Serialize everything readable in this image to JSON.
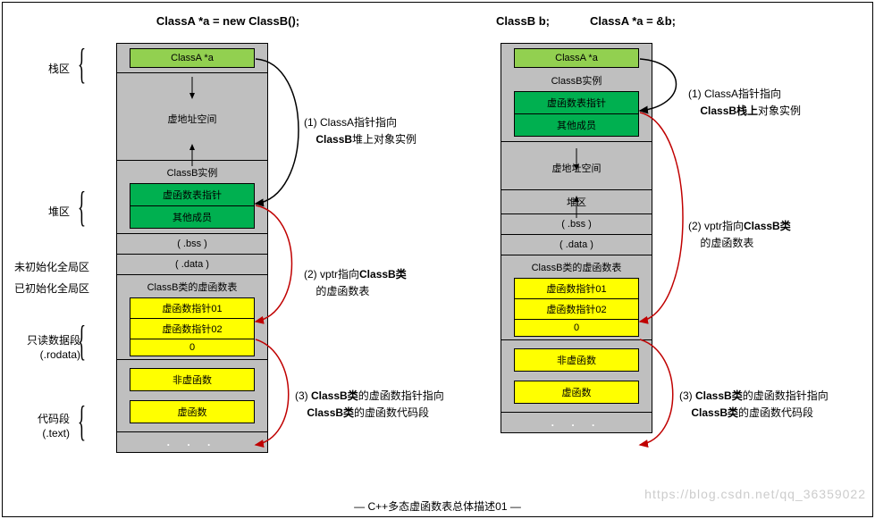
{
  "title_left": "ClassA *a = new ClassB();",
  "title_right_a": "ClassB b;",
  "title_right_b": "ClassA *a = &b;",
  "caption": "—  C++多态虚函数表总体描述01  —",
  "watermark": "https://blog.csdn.net/qq_36359022",
  "mem": {
    "stack": "栈区",
    "heap": "堆区",
    "bss_uninit": "未初始化全局区",
    "bss_init": "已初始化全局区",
    "rodata1": "只读数据段",
    "rodata2": "(.rodata)",
    "text1": "代码段",
    "text2": "(.text)"
  },
  "left": {
    "ptr": "ClassA *a",
    "vspace": "虚地址空间",
    "inst": "ClassB实例",
    "vptr": "虚函数表指针",
    "members": "其他成员",
    "bss": "( .bss )",
    "data": "( .data )",
    "vtbl": "ClassB类的虚函数表",
    "vf1": "虚函数指针01",
    "vf2": "虚函数指针02",
    "zero": "0",
    "nonvf": "非虚函数",
    "vf": "虚函数",
    "dots": ". . ."
  },
  "right": {
    "ptr": "ClassA *a",
    "inst": "ClassB实例",
    "vptr": "虚函数表指针",
    "members": "其他成员",
    "vspace": "虚地址空间",
    "heap": "堆区",
    "bss": "( .bss )",
    "data": "( .data )",
    "vtbl": "ClassB类的虚函数表",
    "vf1": "虚函数指针01",
    "vf2": "虚函数指针02",
    "zero": "0",
    "nonvf": "非虚函数",
    "vf": "虚函数",
    "dots": ". . ."
  },
  "ann": {
    "l1a": "(1) ClassA指针指向",
    "l1b": "ClassB堆上对象实例",
    "l2a": "(2) vptr指向ClassB类",
    "l2b": "的虚函数表",
    "l3a": "(3) ClassB类的虚函数指针指向",
    "l3b": "ClassB类的虚函数代码段",
    "r1a": "(1) ClassA指针指向",
    "r1b": "ClassB栈上对象实例",
    "r2a": "(2) vptr指向ClassB类",
    "r2b": "的虚函数表",
    "r3a": "(3) ClassB类的虚函数指针指向",
    "r3b": "ClassB类的虚函数代码段"
  },
  "b": {
    "ClassB": "ClassB",
    "Bclass": "ClassB类"
  }
}
